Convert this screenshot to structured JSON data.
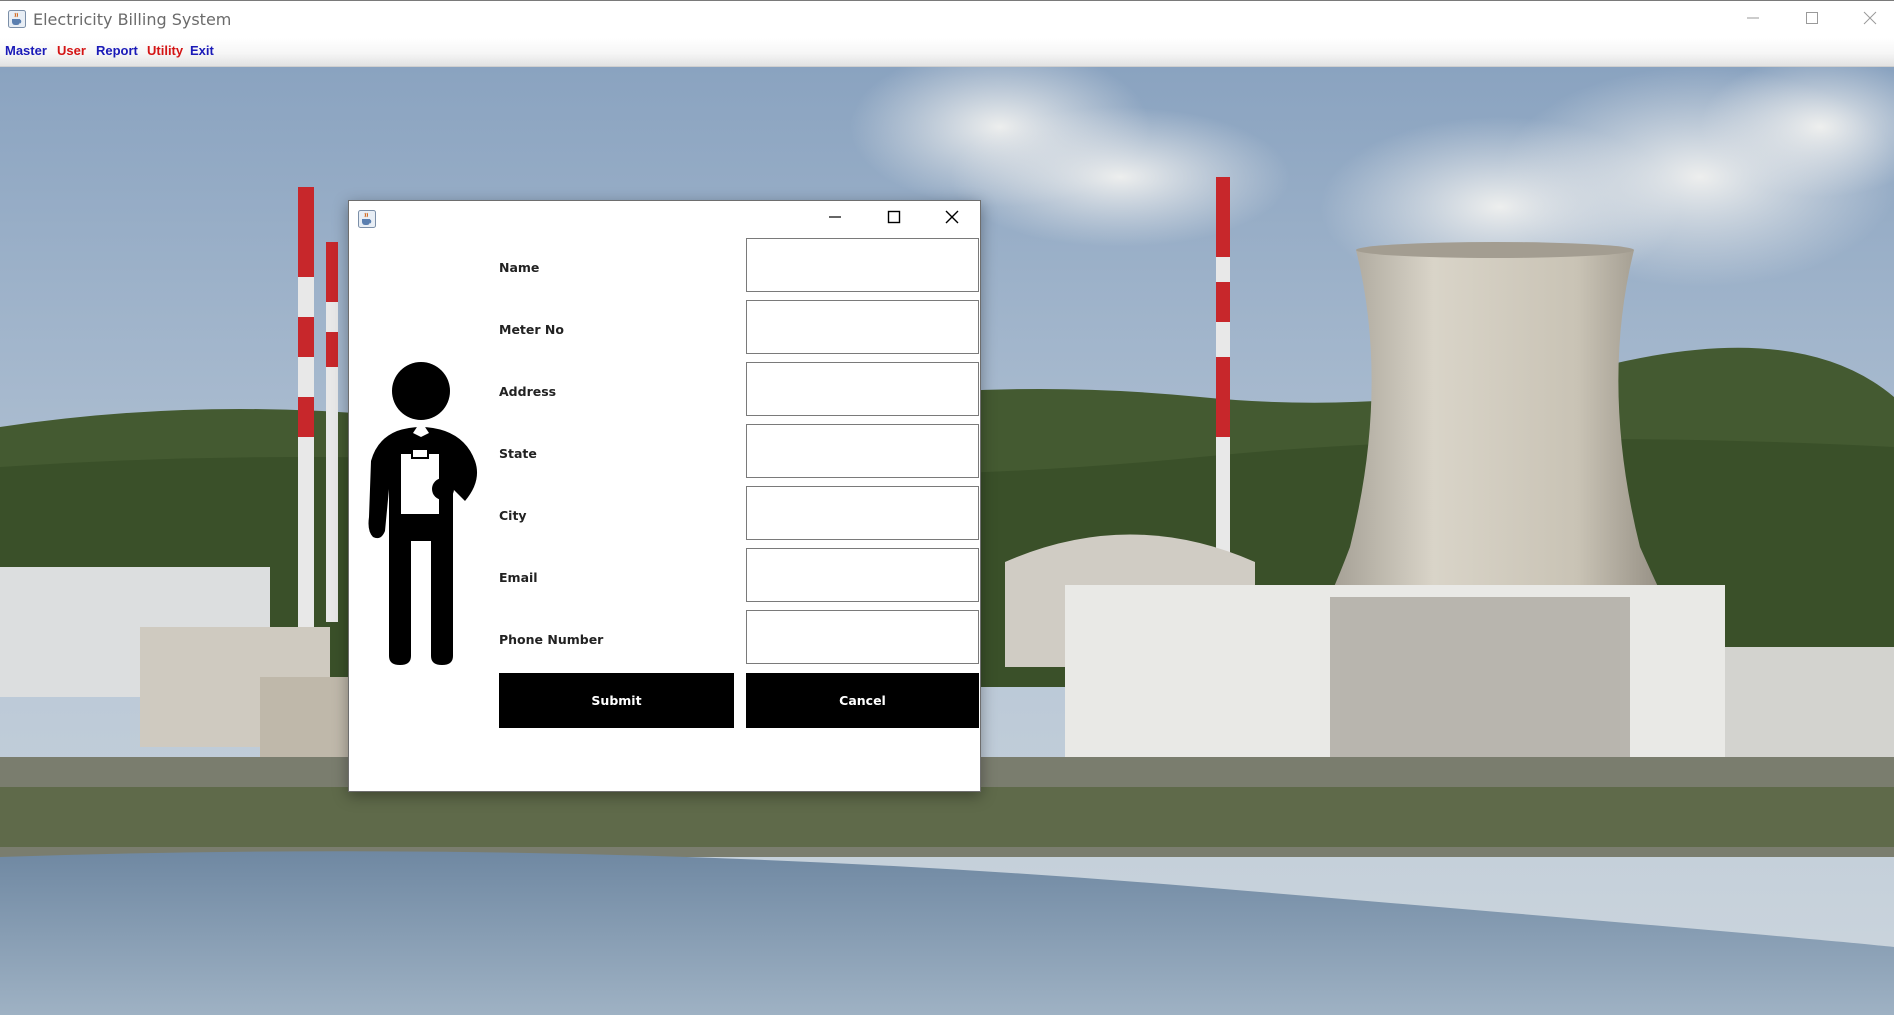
{
  "window": {
    "title": "Electricity Billing System",
    "app_icon": "java-cup-icon",
    "controls": [
      "minimize-icon",
      "maximize-icon",
      "close-icon"
    ]
  },
  "menu": {
    "items": [
      {
        "label": "Master",
        "color": "#1a1ab8"
      },
      {
        "label": "User",
        "color": "#d41414"
      },
      {
        "label": "Report",
        "color": "#1a1ab8"
      },
      {
        "label": "Utility",
        "color": "#d41414"
      },
      {
        "label": "Exit",
        "color": "#1a1ab8"
      }
    ]
  },
  "background": {
    "subject": "power-plant-cooling-tower-photo"
  },
  "dialog": {
    "title": "",
    "icon": "java-cup-icon",
    "illustration": "person-with-clipboard-icon",
    "fields": [
      {
        "label": "Name",
        "value": "",
        "placeholder": ""
      },
      {
        "label": "Meter No",
        "value": "",
        "placeholder": ""
      },
      {
        "label": "Address",
        "value": "",
        "placeholder": ""
      },
      {
        "label": "State",
        "value": "",
        "placeholder": ""
      },
      {
        "label": "City",
        "value": "",
        "placeholder": ""
      },
      {
        "label": "Email",
        "value": "",
        "placeholder": ""
      },
      {
        "label": "Phone Number",
        "value": "",
        "placeholder": ""
      }
    ],
    "buttons": {
      "submit_label": "Submit",
      "cancel_label": "Cancel"
    }
  }
}
